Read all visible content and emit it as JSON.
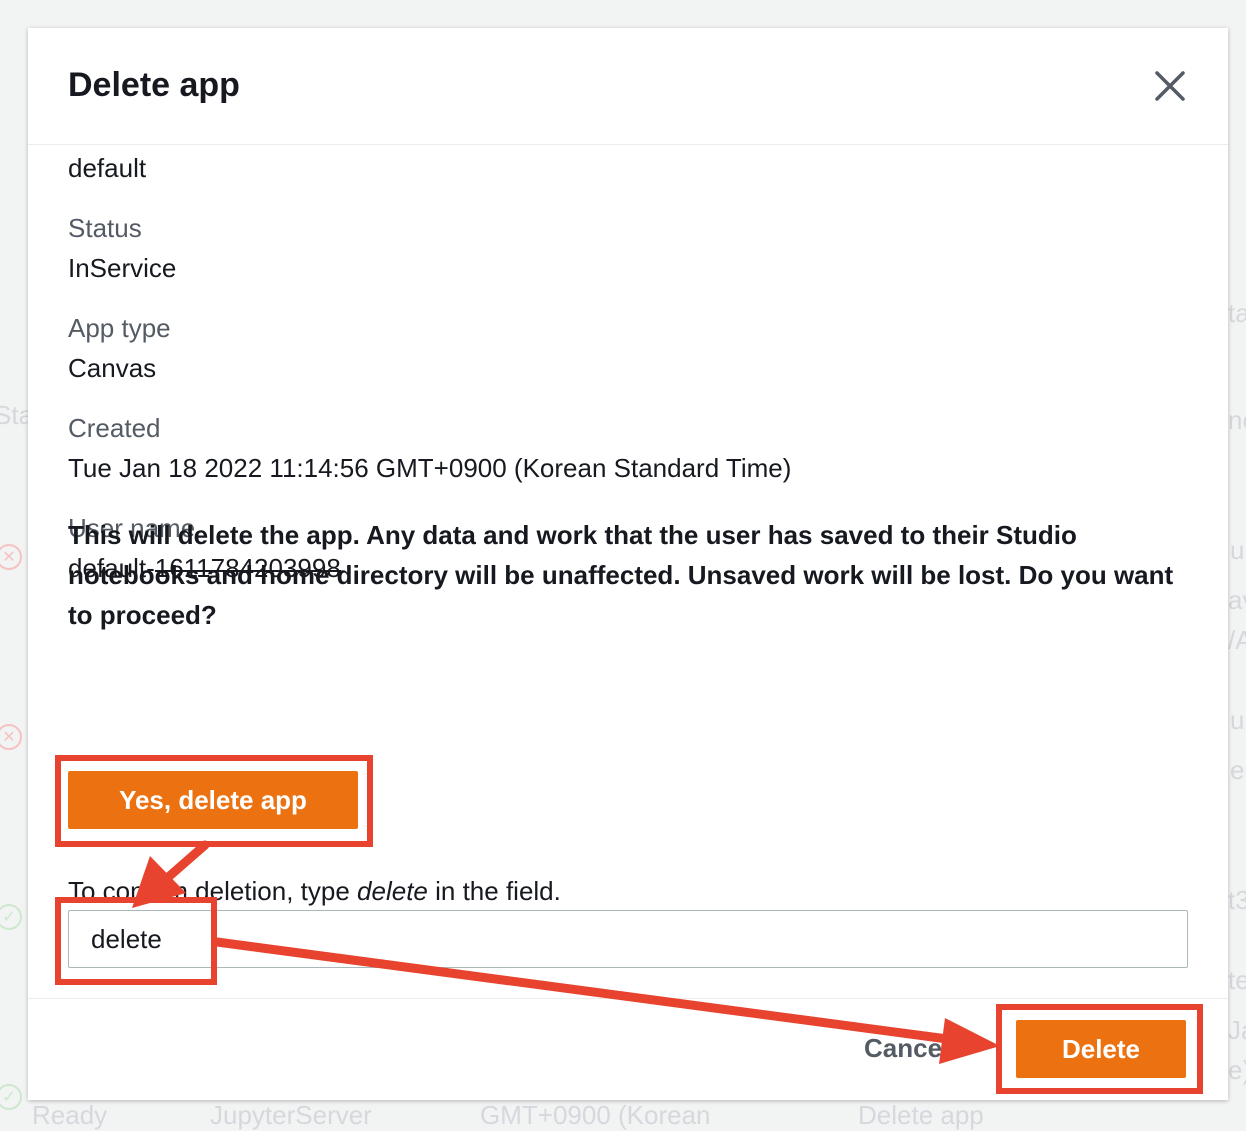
{
  "background": {
    "fragments": [
      "Sta",
      "ta",
      "ne",
      "u",
      "av",
      "/A",
      "u",
      "e",
      "t3",
      "te",
      "Ja",
      "e)",
      "Ready",
      "JupyterServer",
      "GMT+0900 (Korean",
      "Delete app"
    ]
  },
  "modal": {
    "title": "Delete app",
    "close_icon": "close-icon",
    "fields": {
      "app_name_value": "default",
      "status_label": "Status",
      "status_value": "InService",
      "app_type_label": "App type",
      "app_type_value": "Canvas",
      "created_label": "Created",
      "created_value": "Tue Jan 18 2022 11:14:56 GMT+0900 (Korean Standard Time)",
      "user_name_label": "User name",
      "user_name_prefix": "default-",
      "user_name_redacted": "1611784203998"
    },
    "warning": "This will delete the app. Any data and work that the user has saved to their Studio notebooks and home directory will be unaffected. Unsaved work will be lost. Do you want to proceed?",
    "yes_button": "Yes, delete app",
    "confirm": {
      "prefix": "To confirm deletion, type ",
      "keyword": "delete",
      "suffix": " in the field."
    },
    "input_value": "delete",
    "footer": {
      "cancel": "Cancel",
      "delete": "Delete"
    }
  },
  "colors": {
    "accent": "#ec7211",
    "annotation": "#e8432e"
  }
}
